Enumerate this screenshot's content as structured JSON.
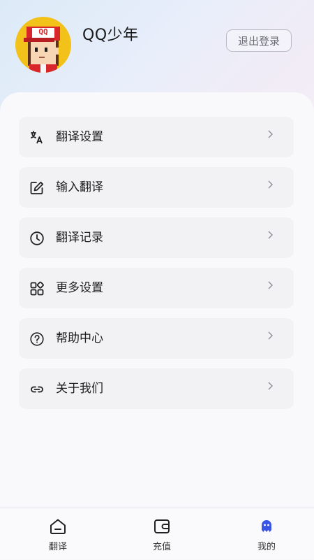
{
  "profile": {
    "username": "QQ少年",
    "avatar_text": "QQ",
    "logout_label": "退出登录"
  },
  "menu": {
    "items": [
      {
        "label": "翻译设置",
        "icon": "translate-icon"
      },
      {
        "label": "输入翻译",
        "icon": "edit-icon"
      },
      {
        "label": "翻译记录",
        "icon": "clock-icon"
      },
      {
        "label": "更多设置",
        "icon": "grid-icon"
      },
      {
        "label": "帮助中心",
        "icon": "help-icon"
      },
      {
        "label": "关于我们",
        "icon": "link-icon"
      }
    ]
  },
  "tabbar": {
    "tabs": [
      {
        "label": "翻译",
        "icon": "home-icon"
      },
      {
        "label": "充值",
        "icon": "wallet-icon"
      },
      {
        "label": "我的",
        "icon": "profile-icon"
      }
    ],
    "active_index": 2
  },
  "colors": {
    "accent": "#3a55e6",
    "avatar_bg": "#f2c21b",
    "cap_red": "#d8262b"
  }
}
